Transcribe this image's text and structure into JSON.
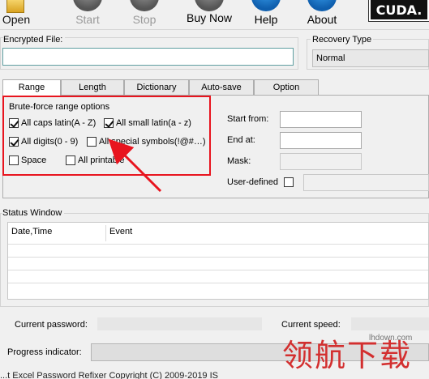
{
  "toolbar": {
    "open": "Open",
    "start": "Start",
    "stop": "Stop",
    "buy_now": "Buy Now",
    "help": "Help",
    "about": "About",
    "cuda": "CUDA."
  },
  "encrypted_file": {
    "label": "Encrypted File:",
    "value": ""
  },
  "recovery_type": {
    "label": "Recovery Type",
    "selected": "Normal"
  },
  "tabs": [
    "Range",
    "Length",
    "Dictionary",
    "Auto-save",
    "Option"
  ],
  "range": {
    "group_title": "Brute-force range options",
    "options": [
      {
        "label": "All caps latin(A - Z)",
        "checked": true
      },
      {
        "label": "All small latin(a - z)",
        "checked": true
      },
      {
        "label": "All digits(0 - 9)",
        "checked": true
      },
      {
        "label": "All special symbols(!@#…)",
        "checked": false
      },
      {
        "label": "Space",
        "checked": false
      },
      {
        "label": "All printable",
        "checked": false
      }
    ],
    "start_from": "Start from:",
    "end_at": "End at:",
    "mask": "Mask:",
    "user_defined": "User-defined"
  },
  "status_window": {
    "title": "Status Window",
    "columns": [
      "Date,Time",
      "Event"
    ]
  },
  "current_password": "Current password:",
  "current_speed": "Current speed:",
  "progress_indicator": "Progress indicator:",
  "watermark": {
    "text": "领航下载",
    "url": "lhdown.com"
  },
  "bottom_text": "...t Excel Password Refixer Copyright (C) 2009-2019 IS"
}
